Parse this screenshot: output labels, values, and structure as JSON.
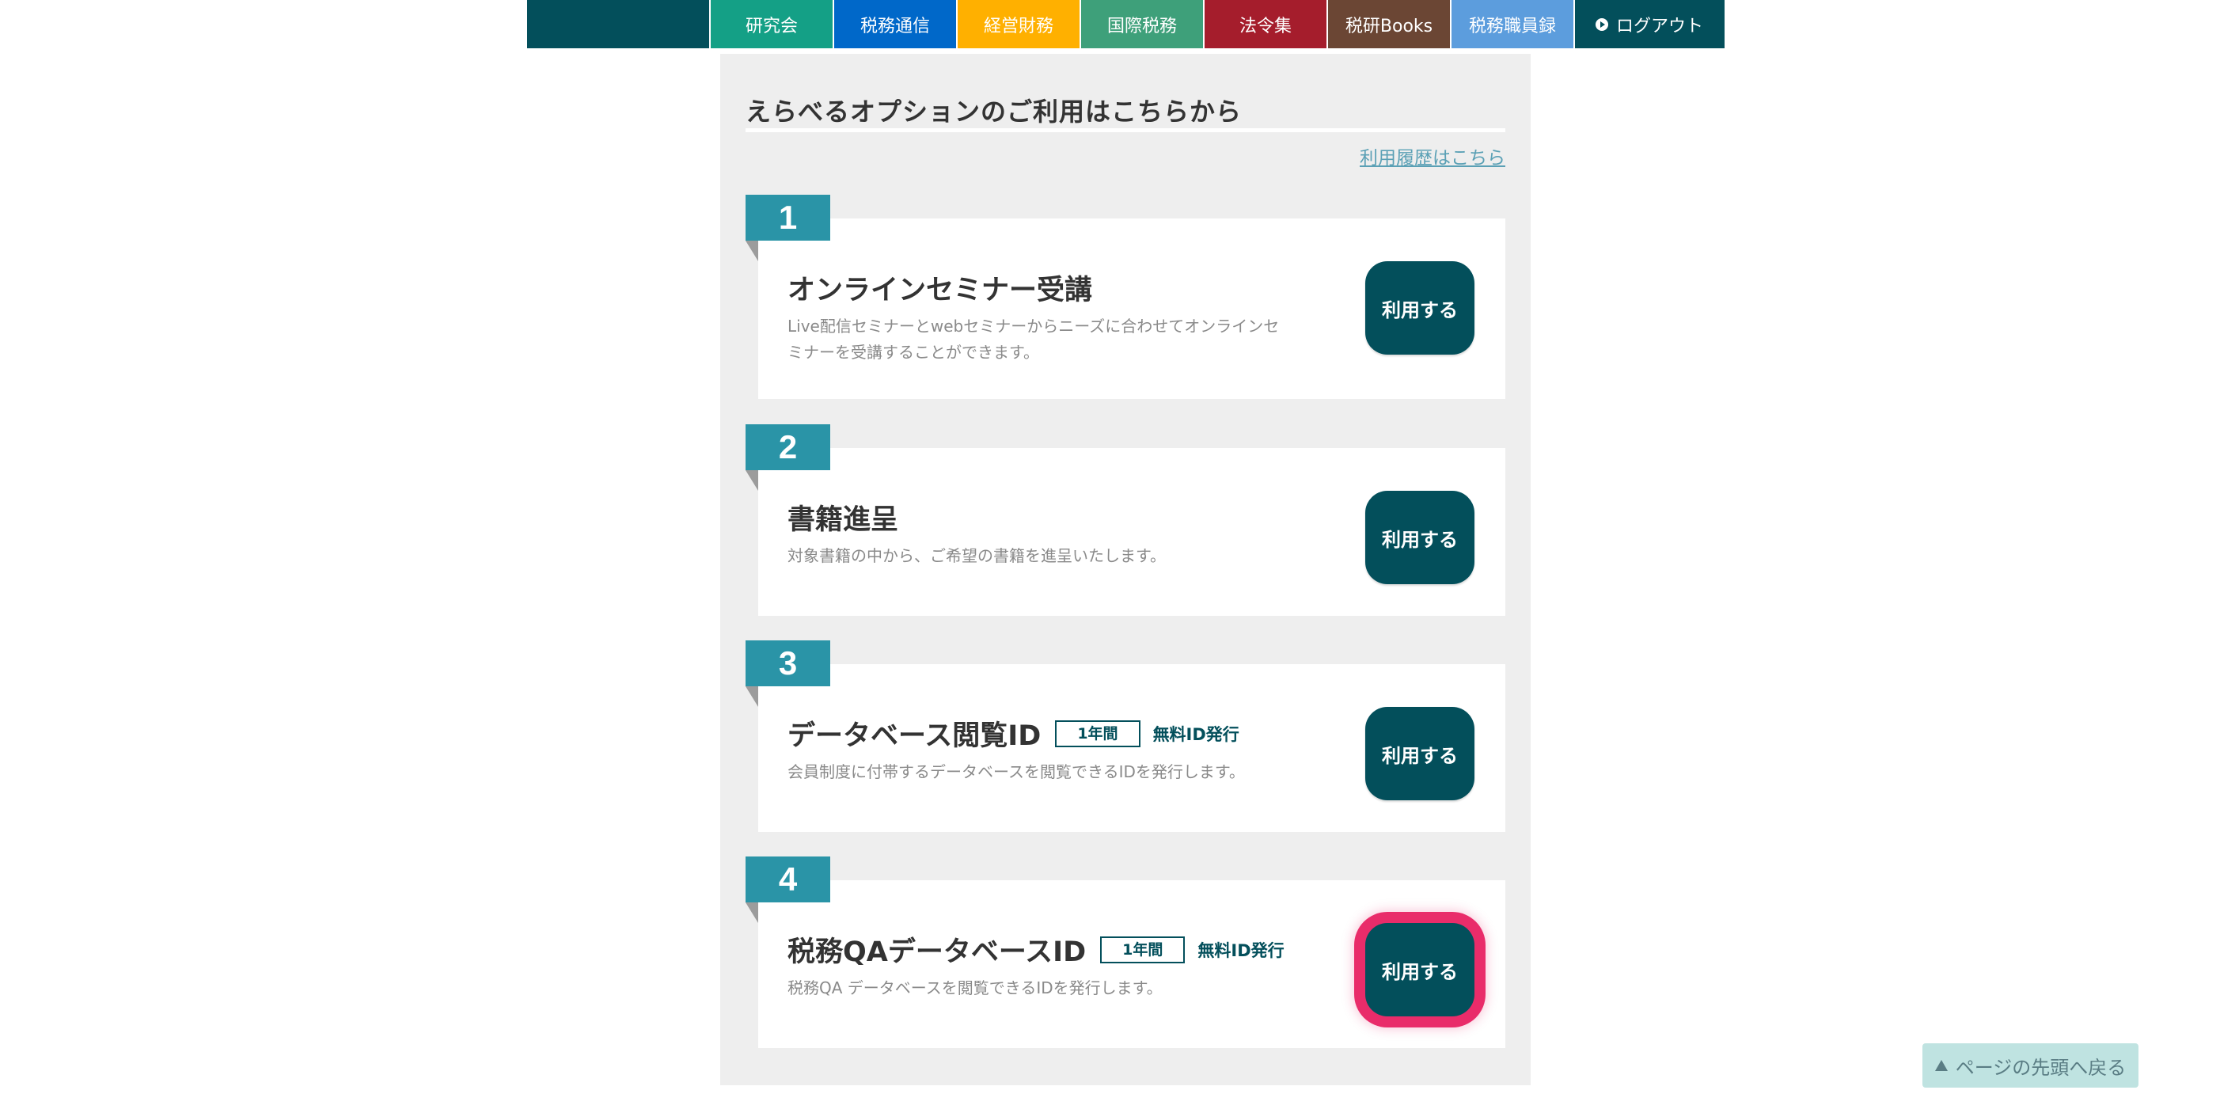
{
  "nav": {
    "tabs": [
      {
        "label": "研究会",
        "color": "#14a086",
        "width": 156
      },
      {
        "label": "税務通信",
        "color": "#0068c9",
        "width": 156
      },
      {
        "label": "経営財務",
        "color": "#ffb000",
        "width": 156
      },
      {
        "label": "国際税務",
        "color": "#3ea07a",
        "width": 156
      },
      {
        "label": "法令集",
        "color": "#a51d2c",
        "width": 156
      },
      {
        "label": "税研Books",
        "color": "#6b4634",
        "width": 156
      },
      {
        "label": "税務職員録",
        "color": "#5c9ddd",
        "width": 156
      }
    ],
    "logout_label": "ログアウト"
  },
  "panel": {
    "title": "えらべるオプションのご利用はこちらから",
    "history_link": "利用履歴はこちら"
  },
  "options": [
    {
      "number": "1",
      "title": "オンラインセミナー受講",
      "desc": "Live配信セミナーとwebセミナーからニーズに合わせてオンラインセミナーを受講することができます。",
      "button": "利用する"
    },
    {
      "number": "2",
      "title": "書籍進呈",
      "desc": "対象書籍の中から、ご希望の書籍を進呈いたします。",
      "button": "利用する"
    },
    {
      "number": "3",
      "title": "データベース閲覧ID",
      "period_badge": "1年間",
      "free_badge": "無料ID発行",
      "desc": "会員制度に付帯するデータベースを閲覧できるIDを発行します。",
      "button": "利用する"
    },
    {
      "number": "4",
      "title": "税務QAデータベースID",
      "period_badge": "1年間",
      "free_badge": "無料ID発行",
      "desc": "税務QA データベースを閲覧できるIDを発行します。",
      "button": "利用する"
    }
  ],
  "back_to_top": "ページの先頭へ戻る",
  "colors": {
    "brand": "#034f5b",
    "accent": "#2a94a7",
    "focus_ring": "#e92c6a"
  }
}
